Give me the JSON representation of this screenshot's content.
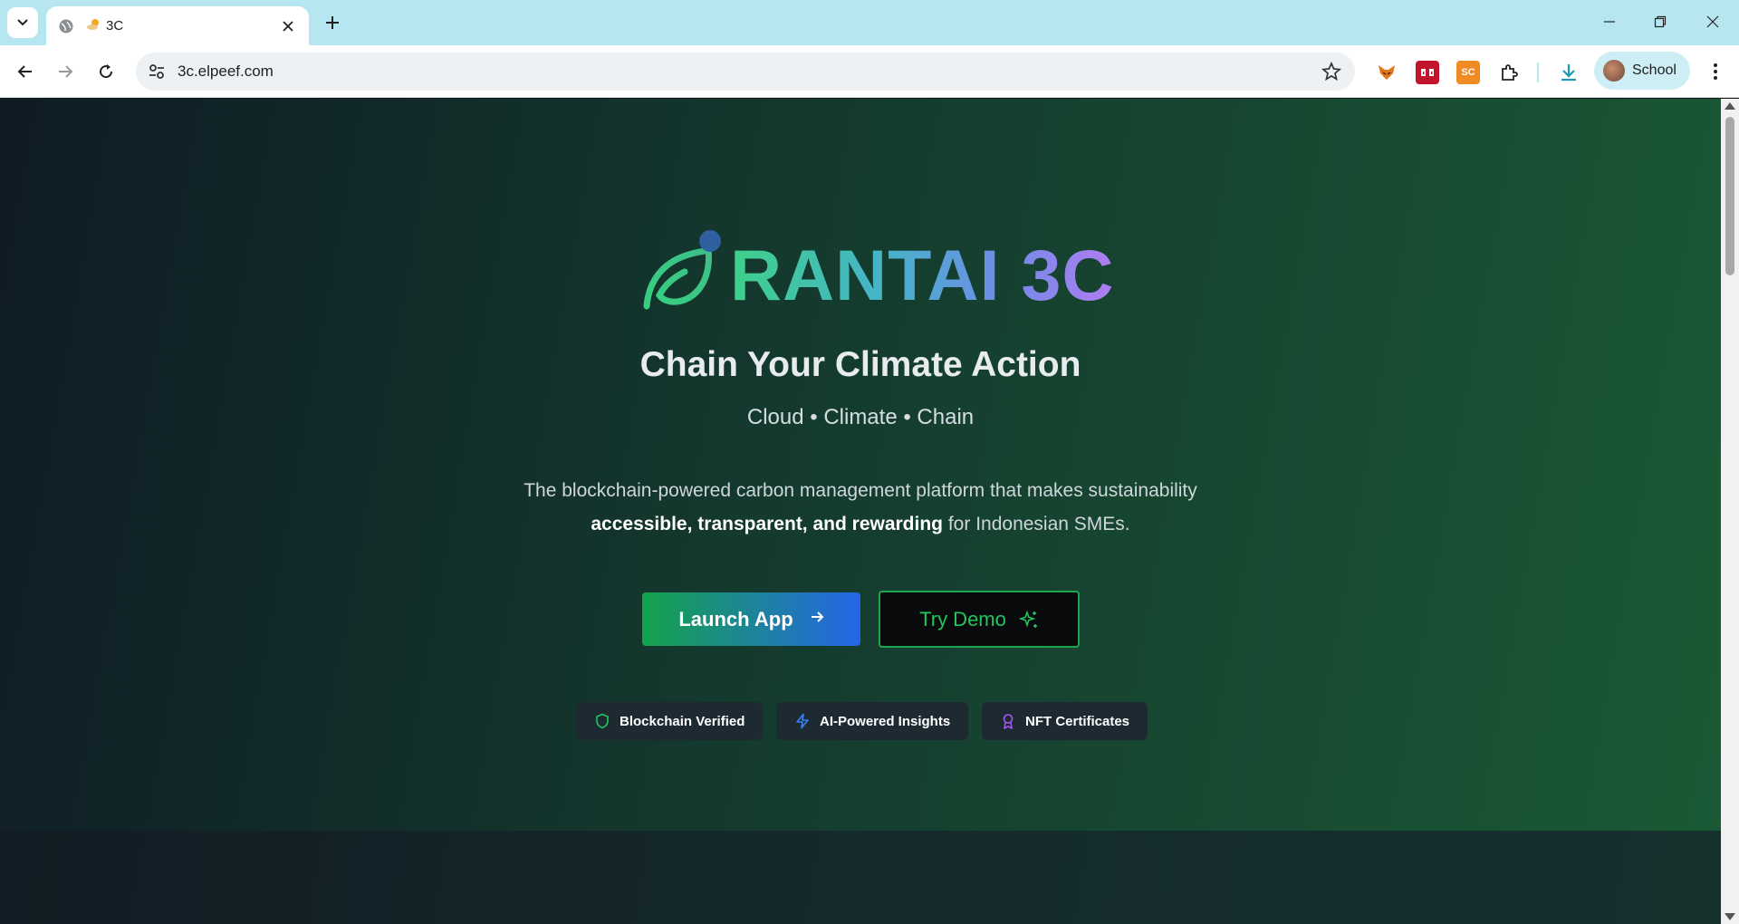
{
  "browser": {
    "tab_title": "3C",
    "url": "3c.elpeef.com",
    "profile_name": "School",
    "extensions": [
      {
        "icon": "fox-extension-icon",
        "label": ""
      },
      {
        "icon": "red-extension-icon",
        "label": ""
      },
      {
        "icon": "sc-extension-icon",
        "label": "SC"
      },
      {
        "icon": "puzzle-icon",
        "label": ""
      }
    ]
  },
  "hero": {
    "brand": "RANTAI 3C",
    "headline": "Chain Your Climate Action",
    "tagline": "Cloud • Climate • Chain",
    "desc_line1": "The blockchain-powered carbon management platform that makes sustainability",
    "desc_bold": "accessible, transparent, and rewarding",
    "desc_rest": " for Indonesian SMEs.",
    "launch_label": "Launch App",
    "demo_label": "Try Demo"
  },
  "badges": [
    {
      "label": "Blockchain Verified",
      "icon": "shield-icon",
      "color": "#22c55e"
    },
    {
      "label": "AI-Powered Insights",
      "icon": "lightning-icon",
      "color": "#3b82f6"
    },
    {
      "label": "NFT Certificates",
      "icon": "award-icon",
      "color": "#a855f7"
    }
  ],
  "colors": {
    "brand_green": "#22c55e",
    "brand_blue": "#2566e6",
    "brand_purple": "#b07cf2",
    "tabstrip": "#b6e6f0"
  }
}
